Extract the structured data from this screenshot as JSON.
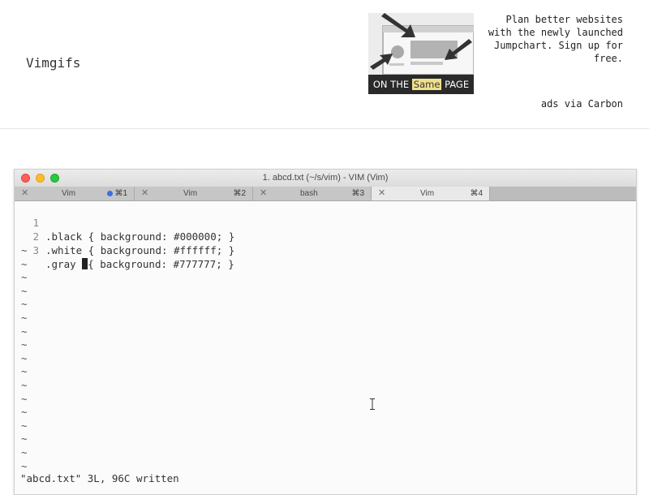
{
  "site": {
    "title": "Vimgifs"
  },
  "ad": {
    "text": "Plan better websites with the newly launched Jumpchart. Sign up for free.",
    "banner_prefix": "ON THE",
    "banner_highlight": "Same",
    "banner_suffix": "PAGE",
    "via": "ads via Carbon"
  },
  "terminal": {
    "window_title": "1. abcd.txt (~/s/vim) - VIM (Vim)",
    "tabs": [
      {
        "close": "✕",
        "label": "Vim",
        "shortcut": "⌘1",
        "has_dot": true
      },
      {
        "close": "✕",
        "label": "Vim",
        "shortcut": "⌘2"
      },
      {
        "close": "✕",
        "label": "bash",
        "shortcut": "⌘3"
      },
      {
        "close": "✕",
        "label": "Vim",
        "shortcut": "⌘4",
        "active": true
      }
    ],
    "lines": [
      {
        "num": "1",
        "text": ".black { background: #000000; }"
      },
      {
        "num": "2",
        "text": ".white { background: #ffffff; }"
      },
      {
        "num": "3",
        "text_before": ".gray ",
        "text_after": "{ background: #777777; }"
      }
    ],
    "tilde": "~",
    "status": "\"abcd.txt\" 3L, 96C written"
  },
  "colors": {
    "dot_blue": "#3a6ee8",
    "ad_highlight": "#f0e08c",
    "traffic_red": "#fc5f57",
    "traffic_yellow": "#fdbc2e",
    "traffic_green": "#28c940"
  }
}
